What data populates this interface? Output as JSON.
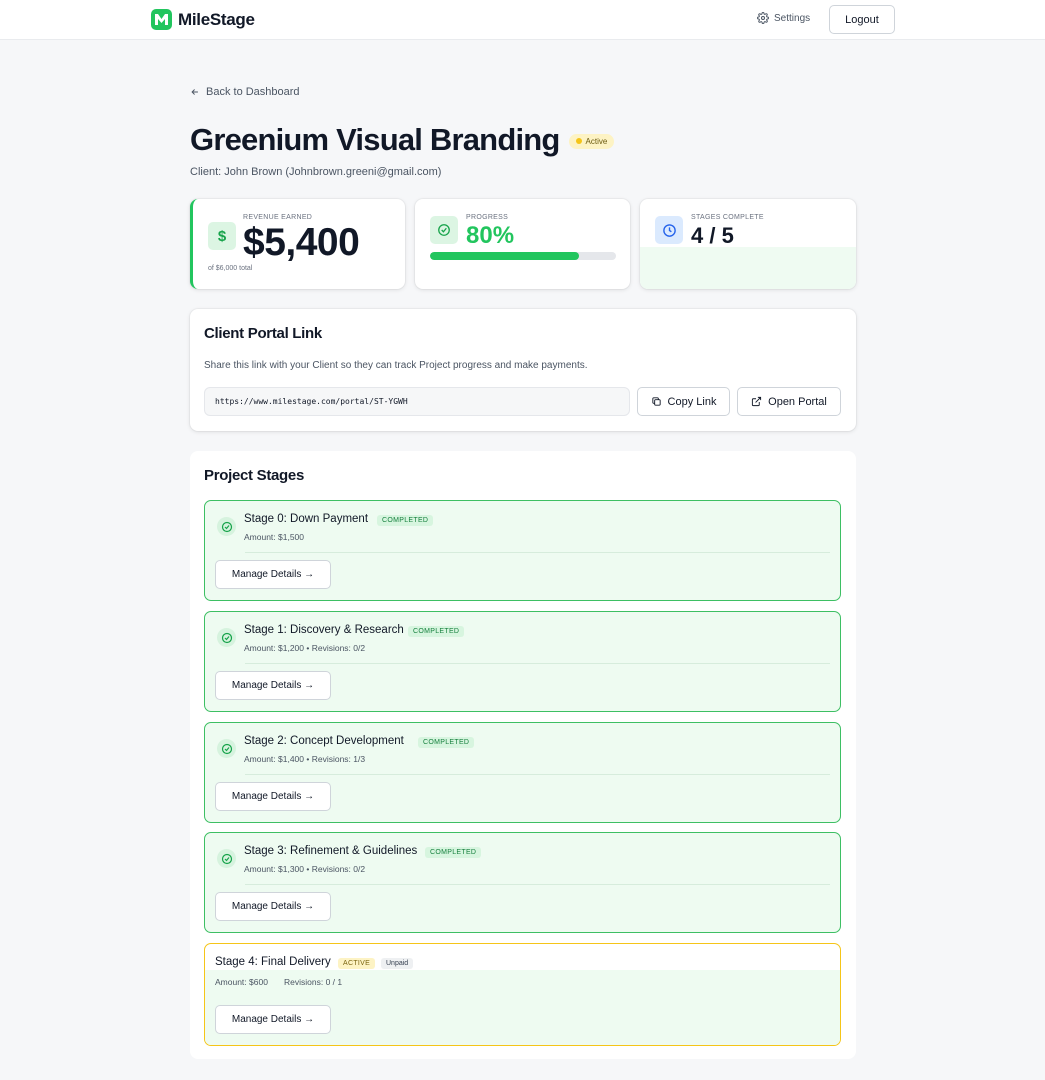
{
  "brand": {
    "name": "MileStage",
    "accent": "#22c55e"
  },
  "nav": {
    "settings_label": "Settings",
    "logout_label": "Logout"
  },
  "back_label": "Back to Dashboard",
  "project": {
    "title": "Greenium Visual Branding",
    "status": "Active",
    "client_line": "Client: John Brown (Johnbrown.greeni@gmail.com)"
  },
  "stats": {
    "revenue": {
      "label": "REVENUE EARNED",
      "value": "$5,400",
      "sub": "of $6,000 total"
    },
    "progress": {
      "label": "PROGRESS",
      "value": "80%",
      "percent": 80
    },
    "stages": {
      "label": "STAGES COMPLETE",
      "value": "4 / 5"
    }
  },
  "portal": {
    "title": "Client Portal Link",
    "description": "Share this link with your Client so they can track Project progress and make payments.",
    "url": "https://www.milestage.com/portal/ST-YGWH",
    "copy_label": "Copy Link",
    "open_label": "Open Portal"
  },
  "stages_section": {
    "title": "Project Stages",
    "manage_label": "Manage Details →",
    "items": [
      {
        "name": "Stage 0: Down Payment",
        "badge": "COMPLETED",
        "meta": "Amount: $1,500"
      },
      {
        "name": "Stage 1: Discovery & Research",
        "badge": "COMPLETED",
        "meta": "Amount: $1,200 • Revisions: 0/2"
      },
      {
        "name": "Stage 2: Concept Development",
        "badge": "COMPLETED",
        "meta": "Amount: $1,400 • Revisions: 1/3"
      },
      {
        "name": "Stage 3: Refinement & Guidelines",
        "badge": "COMPLETED",
        "meta": "Amount: $1,300 • Revisions: 0/2"
      },
      {
        "name": "Stage 4: Final Delivery",
        "badge": "ACTIVE",
        "payment": "Unpaid",
        "amount": "Amount: $600",
        "revisions": "Revisions: 0 / 1"
      }
    ]
  }
}
